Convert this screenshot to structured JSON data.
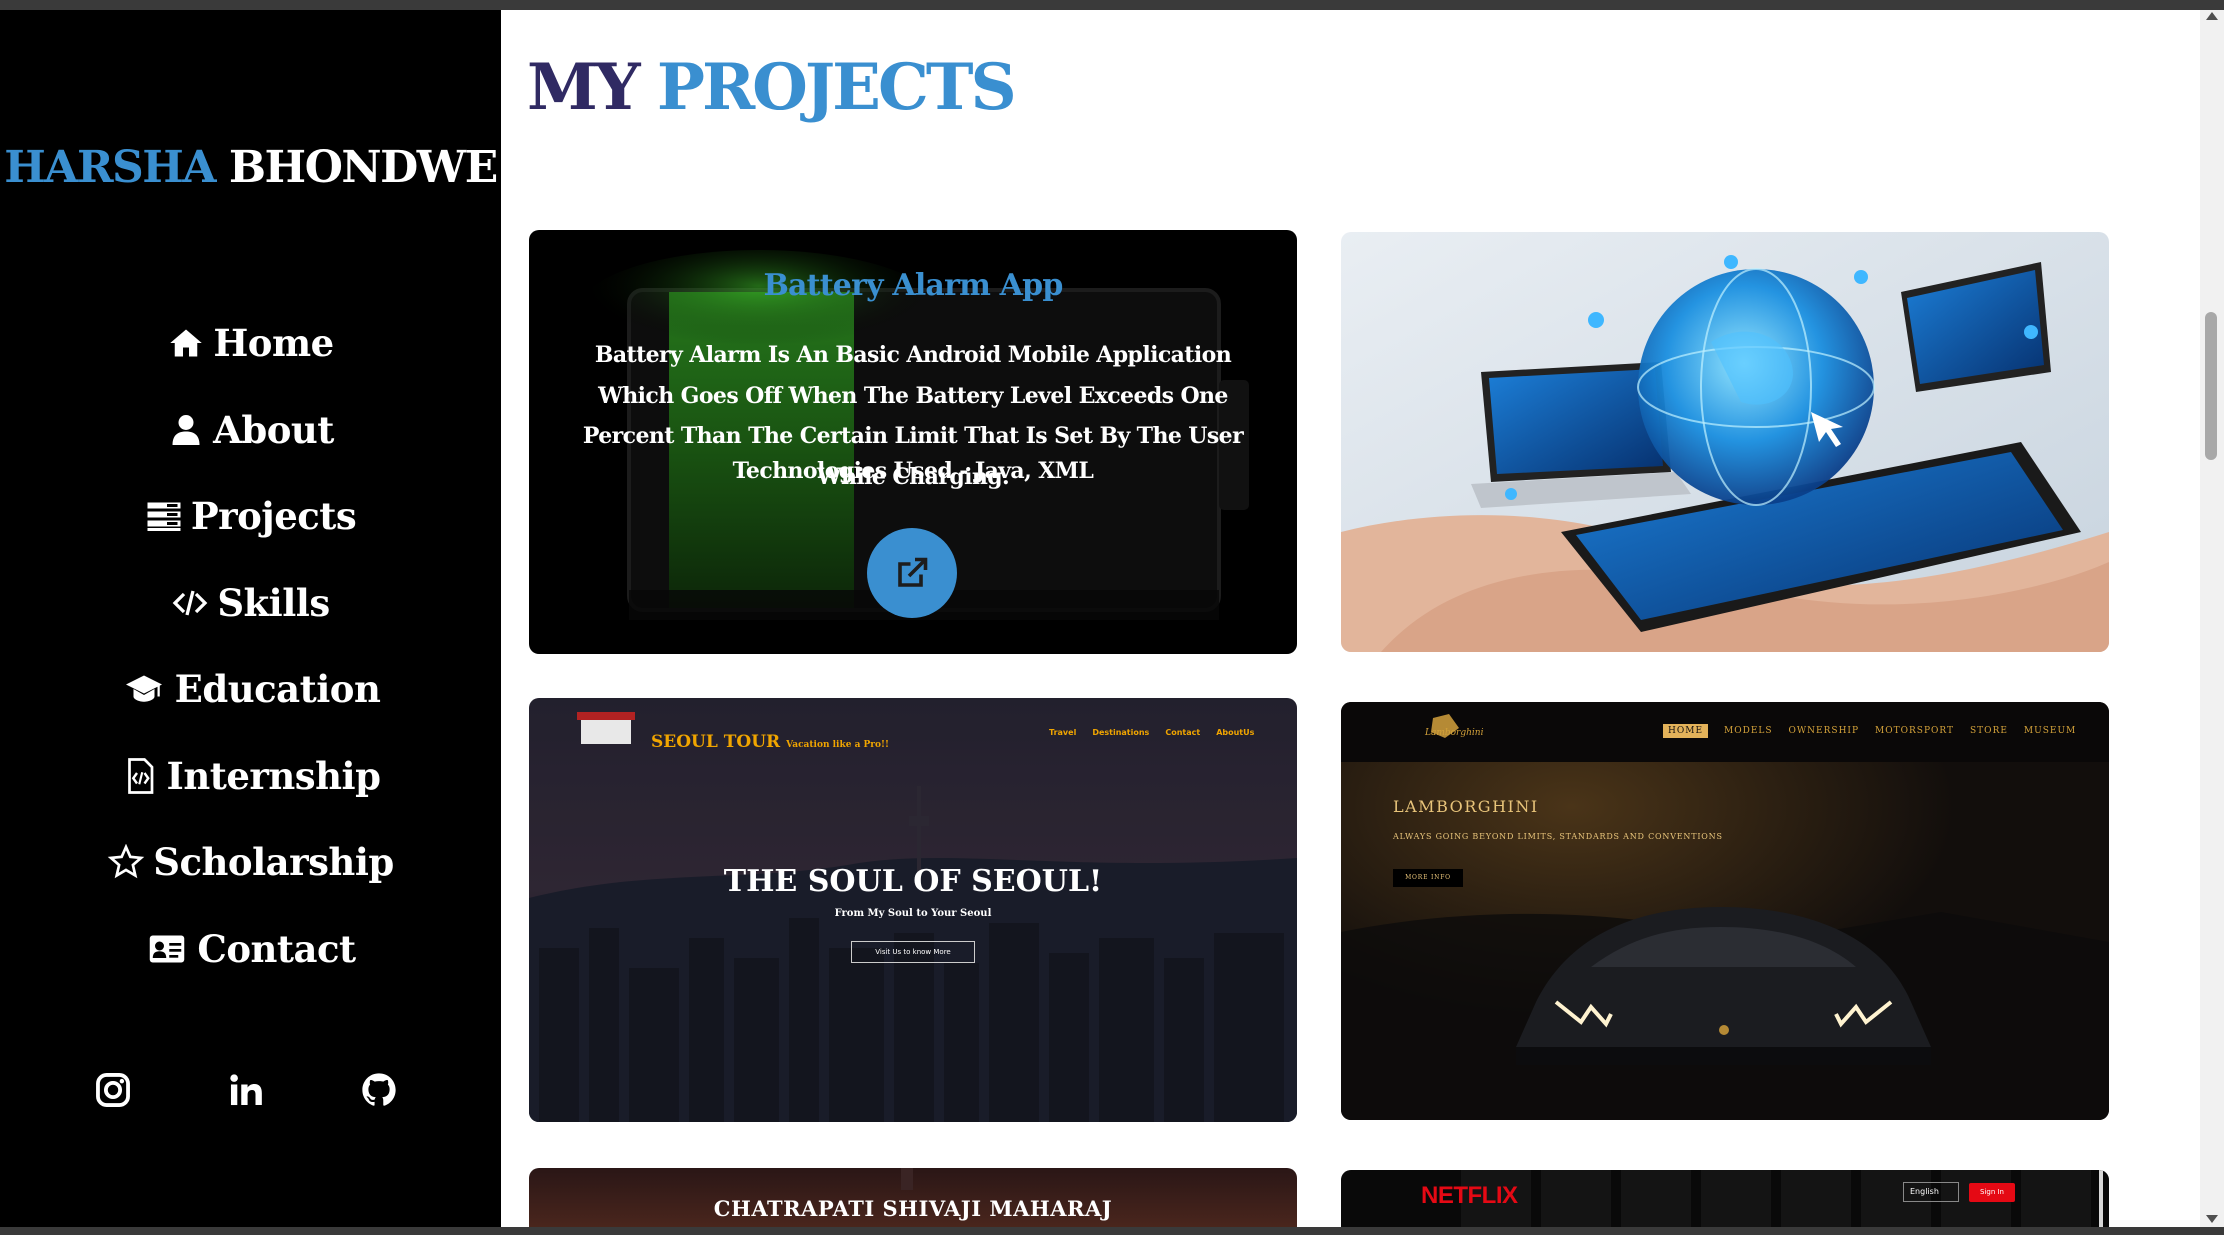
{
  "brand": {
    "first": "HARSHA",
    "last": "BHONDWE"
  },
  "nav": [
    {
      "label": "Home",
      "icon": "home-icon"
    },
    {
      "label": "About",
      "icon": "user-icon"
    },
    {
      "label": "Projects",
      "icon": "projects-icon"
    },
    {
      "label": "Skills",
      "icon": "code-icon"
    },
    {
      "label": "Education",
      "icon": "graduation-cap-icon"
    },
    {
      "label": "Internship",
      "icon": "code-file-icon"
    },
    {
      "label": "Scholarship",
      "icon": "star-icon"
    },
    {
      "label": "Contact",
      "icon": "contact-card-icon"
    }
  ],
  "social": [
    "instagram-icon",
    "linkedin-icon",
    "github-icon"
  ],
  "page_title": {
    "my": "MY",
    "projects": "PROJECTS"
  },
  "projects": {
    "battery": {
      "title": "Battery Alarm App",
      "description": "Battery Alarm Is An Basic Android Mobile Application Which Goes Off When The Battery Level Exceeds One Percent Than The Certain Limit That Is Set By The User While Charging.",
      "tech": "Technologies Used - Java, XML"
    },
    "seoul": {
      "brand": "SEOUL TOUR",
      "tagline": "Vacation like a Pro!!",
      "nav": [
        "Travel",
        "Destinations",
        "Contact",
        "AboutUs"
      ],
      "headline": "THE SOUL OF SEOUL!",
      "subhead": "From My Soul to Your Seoul",
      "button": "Visit Us to know More"
    },
    "lamborghini": {
      "logo": "Lamborghini",
      "nav": [
        "HOME",
        "MODELS",
        "OWNERSHIP",
        "MOTORSPORT",
        "STORE",
        "MUSEUM"
      ],
      "headline": "LAMBORGHINI",
      "subhead": "ALWAYS GOING BEYOND LIMITS, STANDARDS AND CONVENTIONS",
      "button": "MORE INFO"
    },
    "shivaji": {
      "title": "CHATRAPATI SHIVAJI MAHARAJ"
    },
    "netflix": {
      "logo": "NETFLIX",
      "language": "English",
      "signin": "Sign In"
    }
  },
  "colors": {
    "accent": "#3a8fd0",
    "navy": "#302a63",
    "sidebar": "#000000",
    "netflix_red": "#e50914",
    "lambo_gold": "#d4a23a"
  }
}
